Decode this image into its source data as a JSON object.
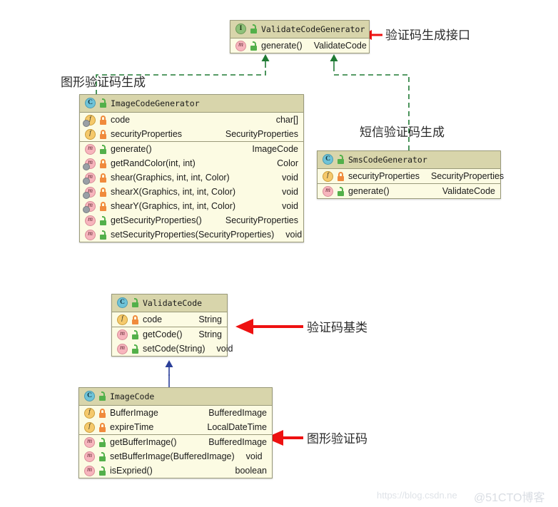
{
  "diagram": {
    "title": "ValidateCode class hierarchy",
    "colors": {
      "box_fill": "#fcfbe3",
      "box_header": "#d8d5ab",
      "box_border": "#9a9a7a",
      "realization_line": "#1f7a34",
      "inheritance_line": "#2b3f99",
      "annotation_arrow": "#ee1111",
      "interface_icon": "#8fc07a",
      "class_icon": "#6fc3d8",
      "field_icon": "#f5c96b",
      "method_icon": "#f7b5bd",
      "lock_private": "#f08a3c",
      "lock_public": "#53b04a"
    }
  },
  "classes": {
    "validate_code_generator": {
      "name": "ValidateCodeGenerator",
      "icon": "interface-icon",
      "stereotype": "I",
      "visibility": "public",
      "fields": [],
      "methods": [
        {
          "icon": "abstract-method-icon",
          "visibility": "public",
          "name": "generate()",
          "type": "ValidateCode"
        }
      ]
    },
    "image_code_generator": {
      "name": "ImageCodeGenerator",
      "icon": "class-icon",
      "stereotype": "C",
      "visibility": "public",
      "fields": [
        {
          "icon": "field-icon",
          "visibility": "private",
          "name": "code",
          "type": "char[]",
          "overlay": "gear"
        },
        {
          "icon": "field-icon",
          "visibility": "private",
          "name": "securityProperties",
          "type": "SecurityProperties"
        }
      ],
      "methods": [
        {
          "icon": "method-icon",
          "visibility": "public",
          "name": "generate()",
          "type": "ImageCode"
        },
        {
          "icon": "method-icon",
          "visibility": "private",
          "name": "getRandColor(int, int)",
          "type": "Color",
          "overlay": "gear"
        },
        {
          "icon": "method-icon",
          "visibility": "private",
          "name": "shear(Graphics, int, int, Color)",
          "type": "void",
          "overlay": "gear"
        },
        {
          "icon": "method-icon",
          "visibility": "private",
          "name": "shearX(Graphics, int, int, Color)",
          "type": "void",
          "overlay": "gear"
        },
        {
          "icon": "method-icon",
          "visibility": "private",
          "name": "shearY(Graphics, int, int, Color)",
          "type": "void",
          "overlay": "gear"
        },
        {
          "icon": "method-icon",
          "visibility": "public",
          "name": "getSecurityProperties()",
          "type": "SecurityProperties"
        },
        {
          "icon": "method-icon",
          "visibility": "public",
          "name": "setSecurityProperties(SecurityProperties)",
          "type": "void"
        }
      ]
    },
    "sms_code_generator": {
      "name": "SmsCodeGenerator",
      "icon": "class-icon",
      "stereotype": "C",
      "visibility": "public",
      "fields": [
        {
          "icon": "field-icon",
          "visibility": "private",
          "name": "securityProperties",
          "type": "SecurityProperties"
        }
      ],
      "methods": [
        {
          "icon": "method-icon",
          "visibility": "public",
          "name": "generate()",
          "type": "ValidateCode"
        }
      ]
    },
    "validate_code": {
      "name": "ValidateCode",
      "icon": "class-icon",
      "stereotype": "C",
      "visibility": "public",
      "fields": [
        {
          "icon": "field-icon",
          "visibility": "private",
          "name": "code",
          "type": "String"
        }
      ],
      "methods": [
        {
          "icon": "method-icon",
          "visibility": "public",
          "name": "getCode()",
          "type": "String"
        },
        {
          "icon": "method-icon",
          "visibility": "public",
          "name": "setCode(String)",
          "type": "void"
        }
      ]
    },
    "image_code": {
      "name": "ImageCode",
      "icon": "class-icon",
      "stereotype": "C",
      "visibility": "public",
      "fields": [
        {
          "icon": "field-icon",
          "visibility": "private",
          "name": "BufferImage",
          "type": "BufferedImage"
        },
        {
          "icon": "field-icon",
          "visibility": "private",
          "name": "expireTime",
          "type": "LocalDateTime"
        }
      ],
      "methods": [
        {
          "icon": "method-icon",
          "visibility": "public",
          "name": "getBufferImage()",
          "type": "BufferedImage"
        },
        {
          "icon": "method-icon",
          "visibility": "public",
          "name": "setBufferImage(BufferedImage)",
          "type": "void"
        },
        {
          "icon": "method-icon",
          "visibility": "public",
          "name": "isExpried()",
          "type": "boolean"
        }
      ]
    }
  },
  "annotations": [
    {
      "id": "annot-generator-interface",
      "label": "验证码生成接口",
      "target": "validate_code_generator",
      "arrow": "red-left-arrow"
    },
    {
      "id": "annot-image-code-gen",
      "label": "图形验证码生成",
      "target": "image_code_generator",
      "arrow": "none"
    },
    {
      "id": "annot-sms-code-gen",
      "label": "短信验证码生成",
      "target": "sms_code_generator",
      "arrow": "none"
    },
    {
      "id": "annot-validate-code",
      "label": "验证码基类",
      "target": "validate_code",
      "arrow": "red-left-arrow"
    },
    {
      "id": "annot-image-code",
      "label": "图形验证码",
      "target": "image_code",
      "arrow": "red-left-arrow"
    }
  ],
  "relations": [
    {
      "from": "image_code_generator",
      "to": "validate_code_generator",
      "kind": "realization",
      "style": "dashed",
      "color": "#1f7a34"
    },
    {
      "from": "sms_code_generator",
      "to": "validate_code_generator",
      "kind": "realization",
      "style": "dashed",
      "color": "#1f7a34"
    },
    {
      "from": "image_code",
      "to": "validate_code",
      "kind": "inheritance",
      "style": "solid",
      "color": "#2b3f99"
    }
  ],
  "watermarks": {
    "csdn": "https://blog.csdn.ne",
    "cto": "@51CTO博客"
  }
}
